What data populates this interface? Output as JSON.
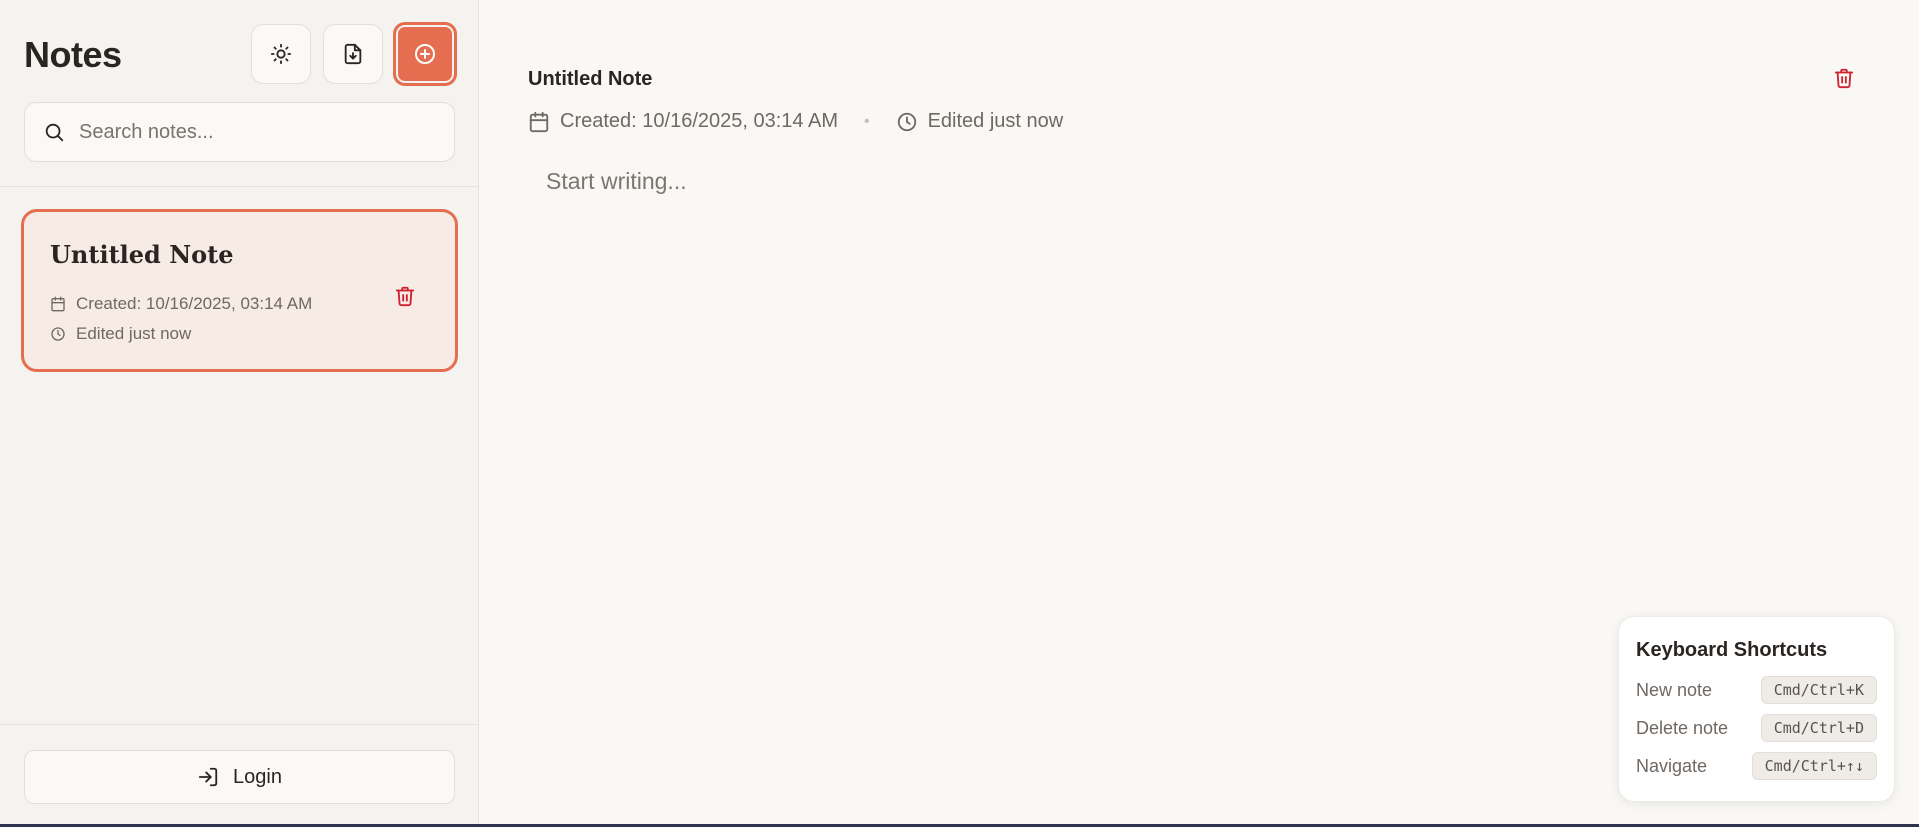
{
  "sidebar": {
    "title": "Notes",
    "search_placeholder": "Search notes...",
    "login_label": "Login"
  },
  "notes": [
    {
      "title": "Untitled Note",
      "created": "Created: 10/16/2025, 03:14 AM",
      "edited": "Edited just now"
    }
  ],
  "editor": {
    "title": "Untitled Note",
    "created": "Created: 10/16/2025, 03:14 AM",
    "separator": "•",
    "edited": "Edited just now",
    "body_placeholder": "Start writing..."
  },
  "shortcuts": {
    "title": "Keyboard Shortcuts",
    "items": [
      {
        "label": "New note",
        "key": "Cmd/Ctrl+K"
      },
      {
        "label": "Delete note",
        "key": "Cmd/Ctrl+D"
      },
      {
        "label": "Navigate",
        "key": "Cmd/Ctrl+↑↓"
      }
    ]
  },
  "colors": {
    "accent": "#e66e50",
    "danger": "#d0202e",
    "sidebar_bg": "#f5f3ef",
    "main_bg": "#f9f8f5",
    "selected_card_bg": "#f6ebe5"
  },
  "icons": {
    "theme": "sun-icon",
    "export": "file-download-icon",
    "new": "plus-circle-icon",
    "search": "search-icon",
    "calendar": "calendar-icon",
    "clock": "clock-icon",
    "delete": "trash-icon",
    "login": "login-icon"
  }
}
